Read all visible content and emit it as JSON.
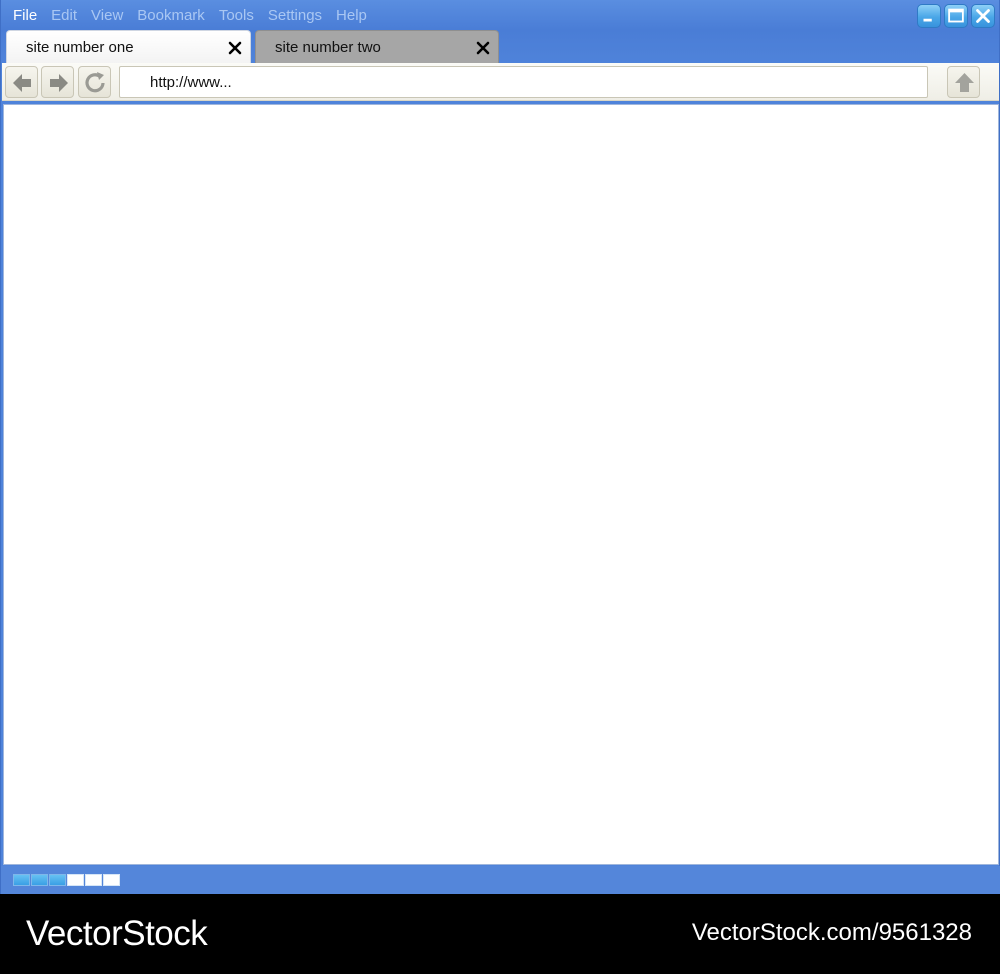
{
  "menu": {
    "items": [
      {
        "label": "File"
      },
      {
        "label": "Edit"
      },
      {
        "label": "View"
      },
      {
        "label": "Bookmark"
      },
      {
        "label": "Tools"
      },
      {
        "label": "Settings"
      },
      {
        "label": "Help"
      }
    ]
  },
  "window_controls": {
    "icons": [
      "minimize-icon",
      "maximize-icon",
      "close-icon"
    ]
  },
  "tabs": [
    {
      "label": "site number one",
      "state": "active"
    },
    {
      "label": "site number two",
      "state": "inactive"
    }
  ],
  "toolbar": {
    "back_icon": "back-arrow-icon",
    "forward_icon": "forward-arrow-icon",
    "reload_icon": "reload-icon",
    "home_icon": "home-icon",
    "url": "http://www..."
  },
  "status": {
    "progress_filled_segments": 3,
    "progress_total_segments": 6
  },
  "footer": {
    "brand": "VectorStock",
    "url": "VectorStock.com/9561328"
  },
  "colors": {
    "titlebar": "#4a7dd6",
    "menu_active": "#ffffff",
    "menu_inactive": "#a9c7f3",
    "tab_inactive": "#a6a6a6",
    "progress_fill": "#3a9fe5"
  }
}
